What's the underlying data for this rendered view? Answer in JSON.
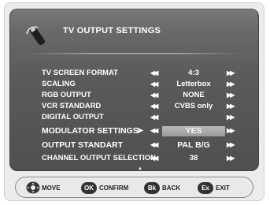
{
  "header": {
    "title": "TV OUTPUT SETTINGS",
    "icon": "tv-remote-icon"
  },
  "menu": {
    "rows": [
      {
        "label": "TV SCREEN FORMAT",
        "value": "4:3"
      },
      {
        "label": "SCALING",
        "value": "Letterbox"
      },
      {
        "label": "RGB OUTPUT",
        "value": "NONE"
      },
      {
        "label": "VCR STANDARD",
        "value": "CVBS only"
      },
      {
        "label": "DIGITAL OUTPUT",
        "value": ""
      },
      {
        "label": "MODULATOR SETTINGS",
        "value": "YES",
        "selected": true
      },
      {
        "label": "OUTPUT STANDART",
        "value": "PAL B/G"
      },
      {
        "label": "CHANNEL OUTPUT SELECTION",
        "value": "38"
      }
    ],
    "arrow_left": "◀◀",
    "arrow_right": "▶▶",
    "pointer": "➤"
  },
  "footer": {
    "move_icon": "dpad-icon",
    "move_label": "MOVE",
    "ok_btn": "OK",
    "ok_label": "CONFIRM",
    "bk_btn": "Bk",
    "bk_label": "BACK",
    "ex_btn": "Ex",
    "ex_label": "EXIT"
  }
}
